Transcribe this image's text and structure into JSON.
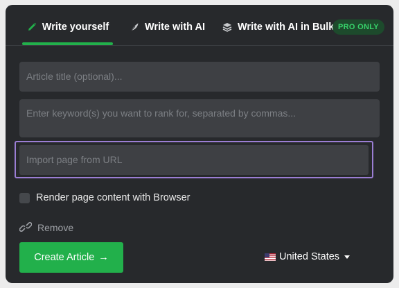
{
  "tabs": [
    {
      "label": "Write yourself",
      "icon": "pencil-icon",
      "active": true
    },
    {
      "label": "Write with AI",
      "icon": "feather-icon"
    },
    {
      "label": "Write with AI in Bulk",
      "icon": "layers-icon"
    }
  ],
  "pro_badge": "PRO ONLY",
  "form": {
    "title_placeholder": "Article title (optional)...",
    "keywords_placeholder": "Enter keyword(s) you want to rank for, separated by commas...",
    "url_placeholder": "Import page from URL",
    "render_checkbox_label": "Render page content with Browser",
    "remove_label": "Remove",
    "create_button_label": "Create Article",
    "create_button_arrow": "→",
    "country": "United States"
  },
  "colors": {
    "panel_bg": "#27292c",
    "accent_green": "#22b04b",
    "field_bg": "#3e4044",
    "highlight_outline": "#9b7ed4"
  }
}
